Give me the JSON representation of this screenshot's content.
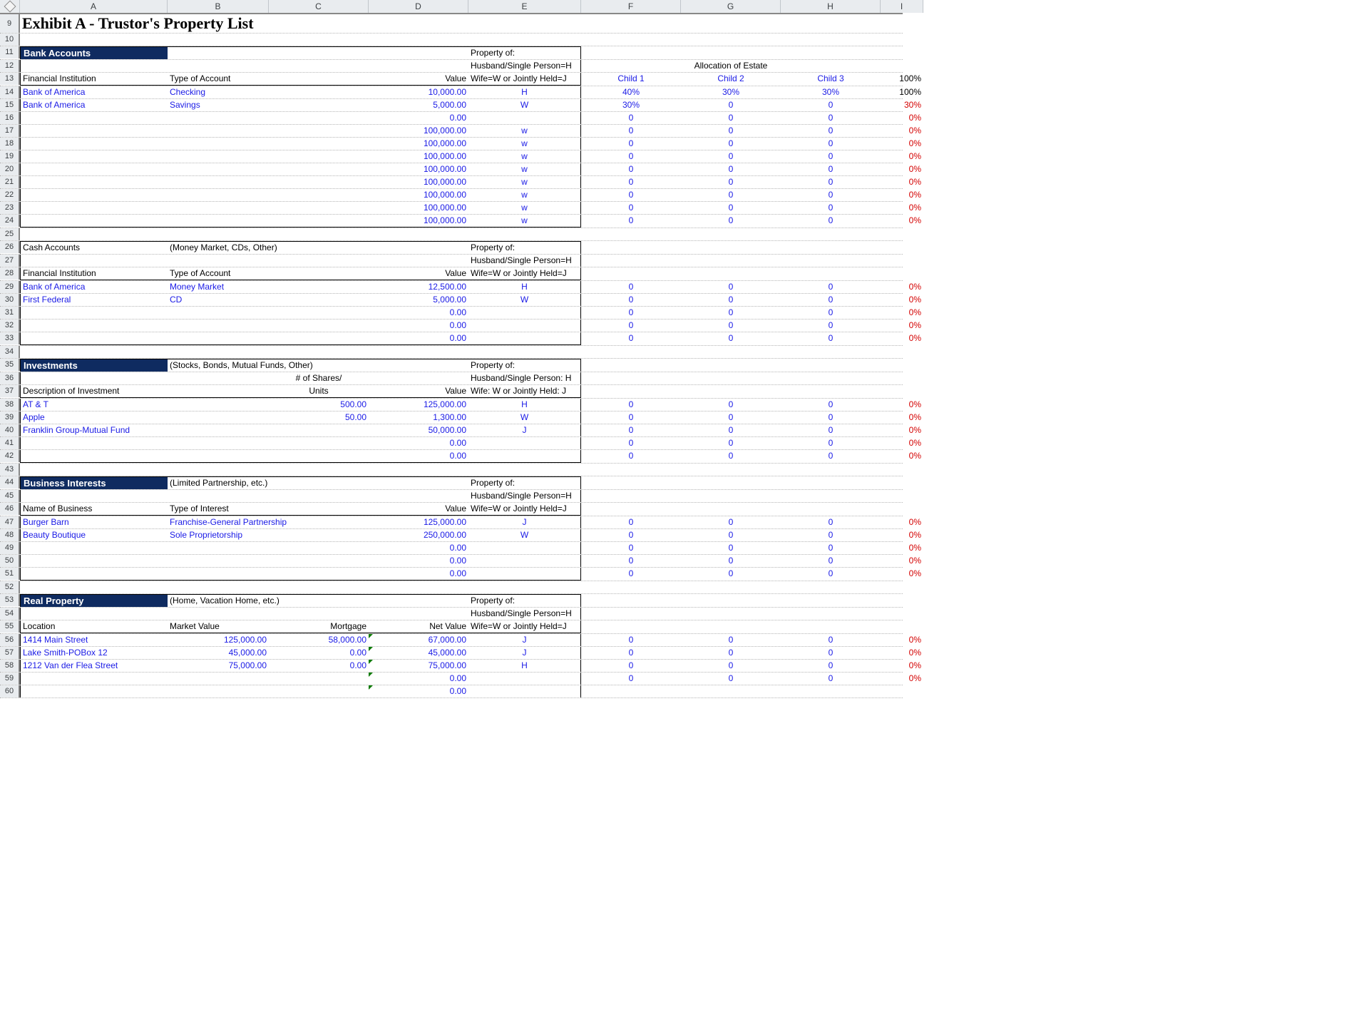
{
  "columns": [
    "",
    "A",
    "B",
    "C",
    "D",
    "E",
    "F",
    "G",
    "H",
    "I"
  ],
  "title": "Exhibit A - Trustor's Property List",
  "alloc_header": "Allocation of Estate",
  "child_labels": [
    "Child 1",
    "Child 2",
    "Child 3"
  ],
  "pct_100": "100%",
  "property_of": "Property of:",
  "property_line1": "Husband/Single Person=H",
  "property_line2": "Wife=W or Jointly Held=J",
  "inv_property_line1": "Husband/Single Person: H",
  "inv_property_line2": "Wife: W or Jointly Held: J",
  "sections": {
    "bank": {
      "title": "Bank Accounts",
      "col0": "Financial Institution",
      "col1": "Type of Account",
      "col3": "Value",
      "rows": [
        {
          "rn": "14",
          "a": "Bank of America",
          "b": "Checking",
          "d": "10,000.00",
          "e": "H",
          "f": "40%",
          "g": "30%",
          "h": "30%",
          "i": "100%",
          "i_red": false
        },
        {
          "rn": "15",
          "a": "Bank of America",
          "b": "Savings",
          "d": "5,000.00",
          "e": "W",
          "f": "30%",
          "g": "0",
          "h": "0",
          "i": "30%",
          "i_red": true
        },
        {
          "rn": "16",
          "a": "",
          "b": "",
          "d": "0.00",
          "e": "",
          "f": "0",
          "g": "0",
          "h": "0",
          "i": "0%",
          "i_red": true
        },
        {
          "rn": "17",
          "a": "",
          "b": "",
          "d": "100,000.00",
          "e": "w",
          "f": "0",
          "g": "0",
          "h": "0",
          "i": "0%",
          "i_red": true
        },
        {
          "rn": "18",
          "a": "",
          "b": "",
          "d": "100,000.00",
          "e": "w",
          "f": "0",
          "g": "0",
          "h": "0",
          "i": "0%",
          "i_red": true
        },
        {
          "rn": "19",
          "a": "",
          "b": "",
          "d": "100,000.00",
          "e": "w",
          "f": "0",
          "g": "0",
          "h": "0",
          "i": "0%",
          "i_red": true
        },
        {
          "rn": "20",
          "a": "",
          "b": "",
          "d": "100,000.00",
          "e": "w",
          "f": "0",
          "g": "0",
          "h": "0",
          "i": "0%",
          "i_red": true
        },
        {
          "rn": "21",
          "a": "",
          "b": "",
          "d": "100,000.00",
          "e": "w",
          "f": "0",
          "g": "0",
          "h": "0",
          "i": "0%",
          "i_red": true
        },
        {
          "rn": "22",
          "a": "",
          "b": "",
          "d": "100,000.00",
          "e": "w",
          "f": "0",
          "g": "0",
          "h": "0",
          "i": "0%",
          "i_red": true
        },
        {
          "rn": "23",
          "a": "",
          "b": "",
          "d": "100,000.00",
          "e": "w",
          "f": "0",
          "g": "0",
          "h": "0",
          "i": "0%",
          "i_red": true
        },
        {
          "rn": "24",
          "a": "",
          "b": "",
          "d": "100,000.00",
          "e": "w",
          "f": "0",
          "g": "0",
          "h": "0",
          "i": "0%",
          "i_red": true
        }
      ]
    },
    "cash": {
      "title": "Cash Accounts",
      "note": "(Money Market, CDs, Other)",
      "col0": "Financial Institution",
      "col1": "Type of Account",
      "col3": "Value",
      "rows": [
        {
          "rn": "29",
          "a": "Bank of America",
          "b": "Money Market",
          "d": "12,500.00",
          "e": "H",
          "f": "0",
          "g": "0",
          "h": "0",
          "i": "0%"
        },
        {
          "rn": "30",
          "a": "First Federal",
          "b": "CD",
          "d": "5,000.00",
          "e": "W",
          "f": "0",
          "g": "0",
          "h": "0",
          "i": "0%"
        },
        {
          "rn": "31",
          "a": "",
          "b": "",
          "d": "0.00",
          "e": "",
          "f": "0",
          "g": "0",
          "h": "0",
          "i": "0%"
        },
        {
          "rn": "32",
          "a": "",
          "b": "",
          "d": "0.00",
          "e": "",
          "f": "0",
          "g": "0",
          "h": "0",
          "i": "0%"
        },
        {
          "rn": "33",
          "a": "",
          "b": "",
          "d": "0.00",
          "e": "",
          "f": "0",
          "g": "0",
          "h": "0",
          "i": "0%"
        }
      ]
    },
    "inv": {
      "title": "Investments",
      "note": "(Stocks, Bonds, Mutual Funds, Other)",
      "col0": "Description of Investment",
      "col1a": "# of Shares/",
      "col1b": "Units",
      "col3": "Value",
      "rows": [
        {
          "rn": "38",
          "a": "AT & T",
          "c": "500.00",
          "d": "125,000.00",
          "e": "H",
          "f": "0",
          "g": "0",
          "h": "0",
          "i": "0%"
        },
        {
          "rn": "39",
          "a": "Apple",
          "c": "50.00",
          "d": "1,300.00",
          "e": "W",
          "f": "0",
          "g": "0",
          "h": "0",
          "i": "0%"
        },
        {
          "rn": "40",
          "a": "Franklin Group-Mutual Fund",
          "c": "",
          "d": "50,000.00",
          "e": "J",
          "f": "0",
          "g": "0",
          "h": "0",
          "i": "0%"
        },
        {
          "rn": "41",
          "a": "",
          "c": "",
          "d": "0.00",
          "e": "",
          "f": "0",
          "g": "0",
          "h": "0",
          "i": "0%"
        },
        {
          "rn": "42",
          "a": "",
          "c": "",
          "d": "0.00",
          "e": "",
          "f": "0",
          "g": "0",
          "h": "0",
          "i": "0%"
        }
      ]
    },
    "biz": {
      "title": "Business Interests",
      "note": "(Limited Partnership, etc.)",
      "col0": "Name of Business",
      "col1": "Type of Interest",
      "col3": "Value",
      "rows": [
        {
          "rn": "47",
          "a": "Burger Barn",
          "b": "Franchise-General Partnership",
          "d": "125,000.00",
          "e": "J",
          "f": "0",
          "g": "0",
          "h": "0",
          "i": "0%"
        },
        {
          "rn": "48",
          "a": "Beauty Boutique",
          "b": "Sole Proprietorship",
          "d": "250,000.00",
          "e": "W",
          "f": "0",
          "g": "0",
          "h": "0",
          "i": "0%"
        },
        {
          "rn": "49",
          "a": "",
          "b": "",
          "d": "0.00",
          "e": "",
          "f": "0",
          "g": "0",
          "h": "0",
          "i": "0%"
        },
        {
          "rn": "50",
          "a": "",
          "b": "",
          "d": "0.00",
          "e": "",
          "f": "0",
          "g": "0",
          "h": "0",
          "i": "0%"
        },
        {
          "rn": "51",
          "a": "",
          "b": "",
          "d": "0.00",
          "e": "",
          "f": "0",
          "g": "0",
          "h": "0",
          "i": "0%"
        }
      ]
    },
    "real": {
      "title": "Real Property",
      "note": "(Home, Vacation Home, etc.)",
      "col0": "Location",
      "col1": "Market Value",
      "col2": "Mortgage",
      "col3": "Net Value",
      "rows": [
        {
          "rn": "56",
          "a": "1414 Main Street",
          "b": "125,000.00",
          "c": "58,000.00",
          "d": "67,000.00",
          "e": "J",
          "f": "0",
          "g": "0",
          "h": "0",
          "i": "0%",
          "tri": true
        },
        {
          "rn": "57",
          "a": "Lake Smith-POBox 12",
          "b": "45,000.00",
          "c": "0.00",
          "d": "45,000.00",
          "e": "J",
          "f": "0",
          "g": "0",
          "h": "0",
          "i": "0%",
          "tri": true
        },
        {
          "rn": "58",
          "a": "1212 Van der Flea Street",
          "b": "75,000.00",
          "c": "0.00",
          "d": "75,000.00",
          "e": "H",
          "f": "0",
          "g": "0",
          "h": "0",
          "i": "0%",
          "tri": true
        },
        {
          "rn": "59",
          "a": "",
          "b": "",
          "c": "",
          "d": "0.00",
          "e": "",
          "f": "0",
          "g": "0",
          "h": "0",
          "i": "0%",
          "tri": true
        },
        {
          "rn": "60",
          "a": "",
          "b": "",
          "c": "",
          "d": "0.00",
          "e": "",
          "f": "",
          "g": "",
          "h": "",
          "i": "",
          "tri": true
        }
      ]
    }
  }
}
